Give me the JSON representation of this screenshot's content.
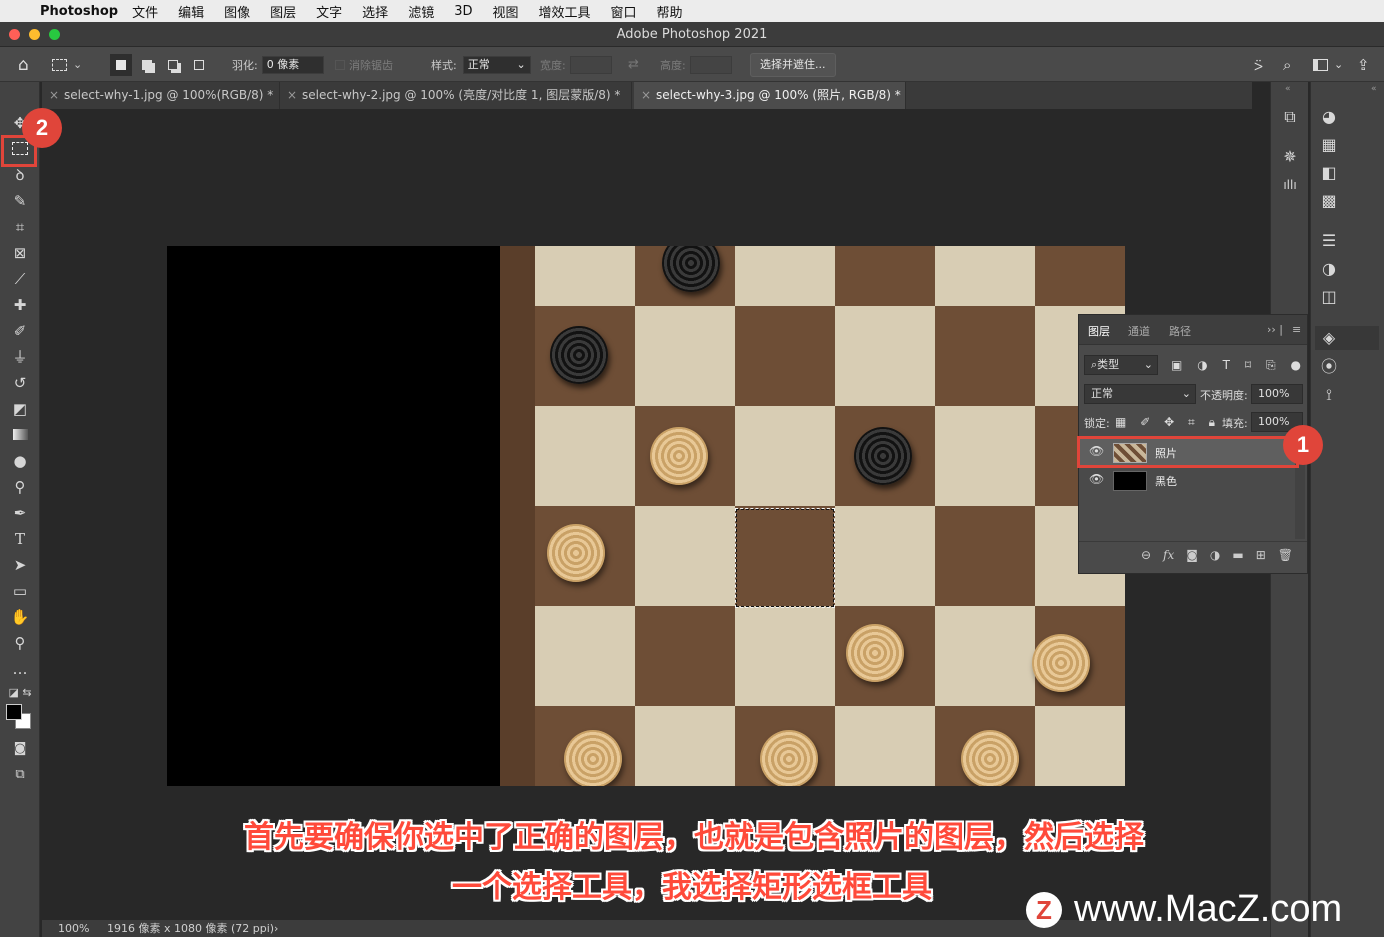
{
  "menubar": {
    "app_name": "Photoshop",
    "items": [
      "文件",
      "编辑",
      "图像",
      "图层",
      "文字",
      "选择",
      "滤镜",
      "3D",
      "视图",
      "增效工具",
      "窗口",
      "帮助"
    ]
  },
  "window": {
    "title": "Adobe Photoshop 2021"
  },
  "options": {
    "feather_label": "羽化:",
    "feather_value": "0 像素",
    "antialias_label": "消除锯齿",
    "style_label": "样式:",
    "style_value": "正常",
    "width_label": "宽度:",
    "height_label": "高度:",
    "select_mask_button": "选择并遮住..."
  },
  "tabs": [
    {
      "label": "select-why-1.jpg @ 100%(RGB/8) *",
      "active": false
    },
    {
      "label": "select-why-2.jpg @ 100% (亮度/对比度 1, 图层蒙版/8) *",
      "active": false
    },
    {
      "label": "select-why-3.jpg @ 100% (照片, RGB/8) *",
      "active": true
    }
  ],
  "layers_panel": {
    "tabs": [
      "图层",
      "通道",
      "路径"
    ],
    "filter_label": "类型",
    "blend_mode": "正常",
    "opacity_label": "不透明度:",
    "opacity_value": "100%",
    "lock_label": "锁定:",
    "fill_label": "填充:",
    "fill_value": "100%",
    "layers": [
      {
        "name": "照片",
        "selected": true
      },
      {
        "name": "黑色",
        "selected": false
      }
    ]
  },
  "annotations": {
    "badge_1": "1",
    "badge_2": "2"
  },
  "status": {
    "zoom": "100%",
    "doc_info": "1916 像素 x 1080 像素 (72 ppi)"
  },
  "captions": {
    "line1": "首先要确保你选中了正确的图层，也就是包含照片的图层，然后选择",
    "line2": "一个选择工具，我选择矩形选框工具"
  },
  "watermark": {
    "logo": "Z",
    "text": "www.MacZ.com"
  },
  "colors": {
    "accent_red": "#e0453a",
    "menubar_bg": "#ececec",
    "panel_bg": "#4a4a4a"
  }
}
